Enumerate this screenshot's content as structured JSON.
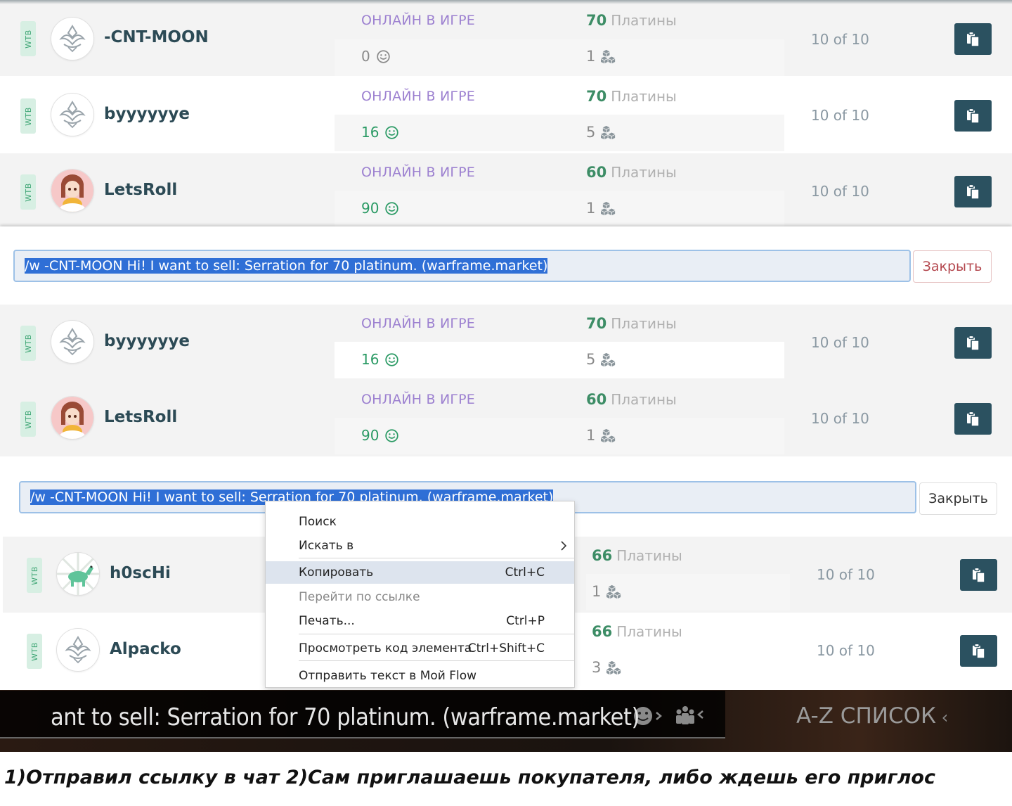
{
  "tag_wtb": "WTB",
  "status_online": "ОНЛАЙН В ИГРЕ",
  "platinum_label": "Платины",
  "close_label": "Закрыть",
  "top_rows": [
    {
      "user": "-CNT-MOON",
      "avatar": "warframe-logo",
      "rep": "0",
      "rep_type": "neutral",
      "price": "70",
      "qty": "1",
      "rank": "10 of 10"
    },
    {
      "user": "byyyyyye",
      "avatar": "warframe-logo",
      "rep": "16",
      "rep_type": "positive",
      "price": "70",
      "qty": "5",
      "rank": "10 of 10"
    },
    {
      "user": "LetsRoll",
      "avatar": "anime-girl",
      "rep": "90",
      "rep_type": "positive",
      "price": "60",
      "qty": "1",
      "rank": "10 of 10"
    }
  ],
  "chat_message_1": "/w -CNT-MOON Hi! I want to sell: Serration for 70 platinum. (warframe.market)",
  "middle_rows": [
    {
      "user": "byyyyyye",
      "avatar": "warframe-logo",
      "rep": "16",
      "rep_type": "positive",
      "price": "70",
      "qty": "5",
      "rank": "10 of 10"
    },
    {
      "user": "LetsRoll",
      "avatar": "anime-girl",
      "rep": "90",
      "rep_type": "positive",
      "price": "60",
      "qty": "1",
      "rank": "10 of 10"
    }
  ],
  "chat_message_2": "/w -CNT-MOON Hi! I want to sell: Serration for 70 platinum. (warframe.market)",
  "bottom_rows": [
    {
      "user": "h0scHi",
      "avatar": "green-horse",
      "price": "66",
      "qty": "1",
      "rank": "10 of 10"
    },
    {
      "user": "Alpacko",
      "avatar": "warframe-logo",
      "price": "66",
      "qty": "3",
      "rank": "10 of 10"
    }
  ],
  "context_menu": {
    "items": [
      {
        "label": "Поиск",
        "shortcut": ""
      },
      {
        "label": "Искать в",
        "shortcut": ""
      },
      {
        "label": "Копировать",
        "shortcut": "Ctrl+C"
      },
      {
        "label": "Перейти по ссылке",
        "shortcut": ""
      },
      {
        "label": "Печать...",
        "shortcut": "Ctrl+P"
      },
      {
        "label": "Просмотреть код элемента",
        "shortcut": "Ctrl+Shift+C"
      },
      {
        "label": "Отправить текст в Мой Flow",
        "shortcut": ""
      }
    ]
  },
  "game_chat_text": "ant to sell: Serration for 70 platinum. (warframe.market)",
  "game_az_label": "A-Z СПИСОК",
  "caption": "1)Отправил ссылку в чат 2)Сам приглашаешь покупателя, либо ждешь его приглос",
  "icons": {
    "copy": "copy-icon",
    "smile": "smile-icon",
    "cubes": "cubes-icon",
    "chevron": "chevron-right-icon"
  }
}
